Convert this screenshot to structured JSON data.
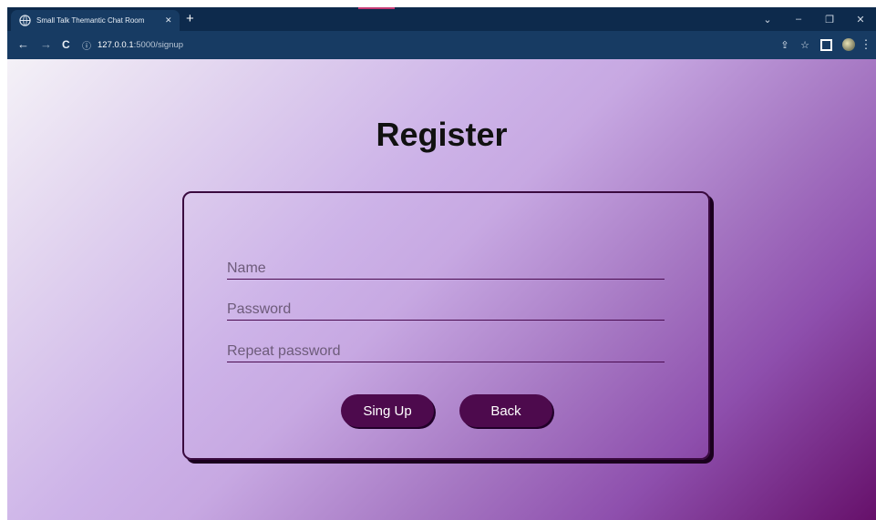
{
  "browser": {
    "tab": {
      "title": "Small Talk Themantic Chat Room",
      "close": "✕"
    },
    "new_tab": "+",
    "controls": {
      "tab_search": "⌄",
      "minimize": "–",
      "restore": "❐",
      "close": "✕"
    },
    "nav": {
      "back": "←",
      "forward": "→",
      "reload": "C"
    },
    "address": {
      "info": "ⓘ",
      "host": "127.0.0.1",
      "path": ":5000/signup"
    },
    "icons": {
      "share": "⇪",
      "bookmark": "☆",
      "menu": "⋮"
    }
  },
  "page": {
    "title": "Register",
    "form": {
      "name_placeholder": "Name",
      "password_placeholder": "Password",
      "repeat_placeholder": "Repeat password",
      "signup_label": "Sing Up",
      "back_label": "Back"
    }
  },
  "colors": {
    "button_bg": "#4d0a4d",
    "card_border": "#3a0a3f",
    "gradient_start": "#f4f1f7",
    "gradient_end": "#66106a"
  }
}
